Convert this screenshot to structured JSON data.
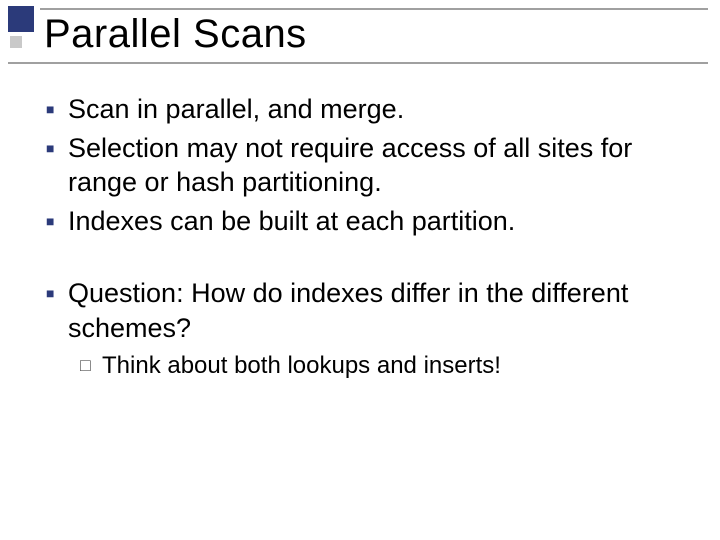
{
  "title": "Parallel Scans",
  "bullets": [
    "Scan in parallel, and merge.",
    "Selection may not require access of all sites for range or hash partitioning.",
    "Indexes can be built at each partition.",
    "Question: How do indexes differ in the different schemes?"
  ],
  "sub": [
    "Think about both lookups and inserts!"
  ]
}
